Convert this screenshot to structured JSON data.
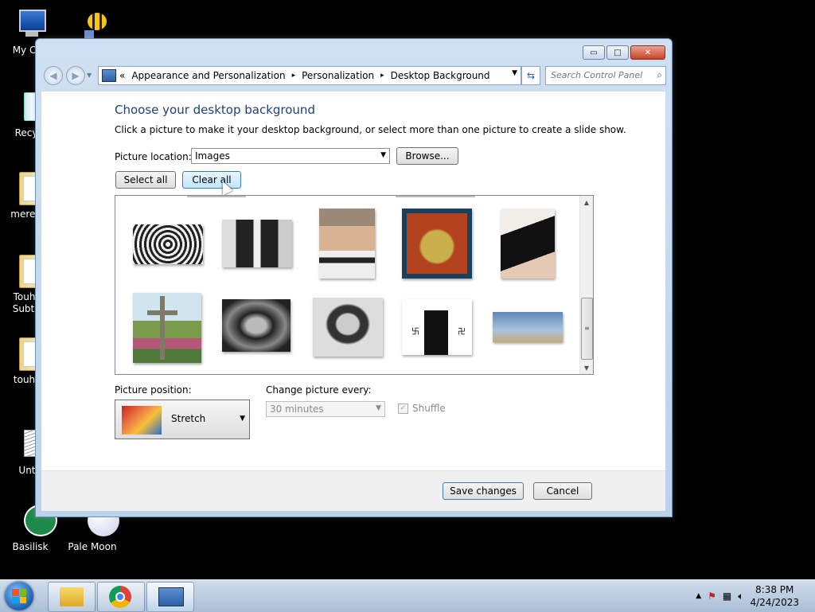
{
  "desktop": {
    "icons": [
      {
        "label": "My Con"
      },
      {
        "label": ""
      },
      {
        "label": "Recycl"
      },
      {
        "label": "meredia"
      },
      {
        "label": "Touhou Subterr"
      },
      {
        "label": "touhou"
      },
      {
        "label": "Untit"
      },
      {
        "label": "Basilisk"
      },
      {
        "label": "Pale Moon"
      }
    ]
  },
  "window": {
    "controls": {
      "minimize": "▭",
      "maximize": "□",
      "close": "✕"
    },
    "address": {
      "prefix": "«",
      "crumbs": [
        "Appearance and Personalization",
        "Personalization",
        "Desktop Background"
      ],
      "separator": "▸"
    },
    "search": {
      "placeholder": "Search Control Panel"
    },
    "heading": "Choose your desktop background",
    "subtext": "Click a picture to make it your desktop background, or select more than one picture to create a slide show.",
    "picture_location": {
      "label": "Picture location:",
      "value": "Images",
      "browse": "Browse..."
    },
    "select_all": "Select all",
    "clear_all": "Clear all",
    "picture_position": {
      "label": "Picture position:",
      "value": "Stretch"
    },
    "change_picture": {
      "label": "Change picture every:",
      "value": "30 minutes"
    },
    "shuffle": {
      "label": "Shuffle",
      "checked_mark": "✓"
    },
    "save": "Save changes",
    "cancel": "Cancel"
  },
  "taskbar": {
    "time": "8:38 PM",
    "date": "4/24/2023"
  }
}
